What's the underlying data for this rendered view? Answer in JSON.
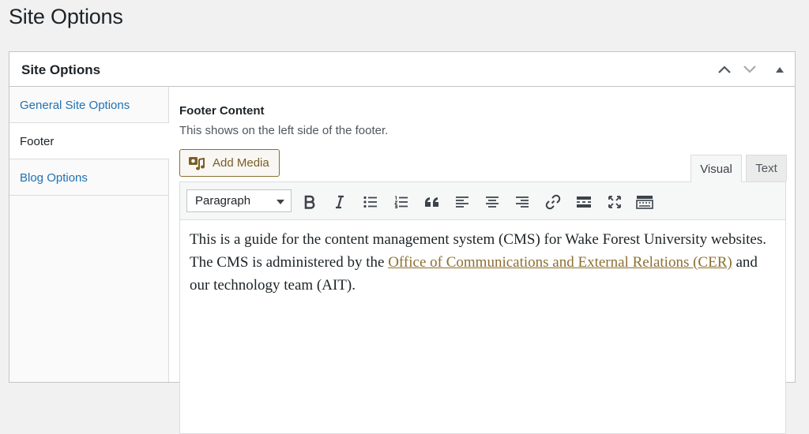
{
  "page": {
    "title": "Site Options"
  },
  "postbox": {
    "title": "Site Options",
    "controls": [
      "chevron-up-icon",
      "chevron-down-icon",
      "triangle-up-icon"
    ]
  },
  "tabs": {
    "items": [
      {
        "label": "General Site Options",
        "active": false
      },
      {
        "label": "Footer",
        "active": true
      },
      {
        "label": "Blog Options",
        "active": false
      }
    ]
  },
  "field": {
    "label": "Footer Content",
    "description": "This shows on the left side of the footer."
  },
  "editor": {
    "add_media_label": "Add Media",
    "tab_visual": "Visual",
    "tab_text": "Text",
    "format_select_value": "Paragraph",
    "toolbar_icons": [
      "bold-icon",
      "italic-icon",
      "bullet-list-icon",
      "numbered-list-icon",
      "blockquote-icon",
      "align-left-icon",
      "align-center-icon",
      "align-right-icon",
      "link-icon",
      "read-more-icon",
      "fullscreen-icon",
      "toolbar-toggle-icon"
    ],
    "body": {
      "text_before": "This is a guide for the content management system (CMS) for Wake Forest University websites. The CMS is administered by the ",
      "link_text": "Office of Communications and External Relations (CER)",
      "text_after": " and our technology team (AIT)."
    }
  },
  "colors": {
    "link": "#2271b1",
    "accent": "#8c6f32",
    "border": "#c3c4c7"
  }
}
